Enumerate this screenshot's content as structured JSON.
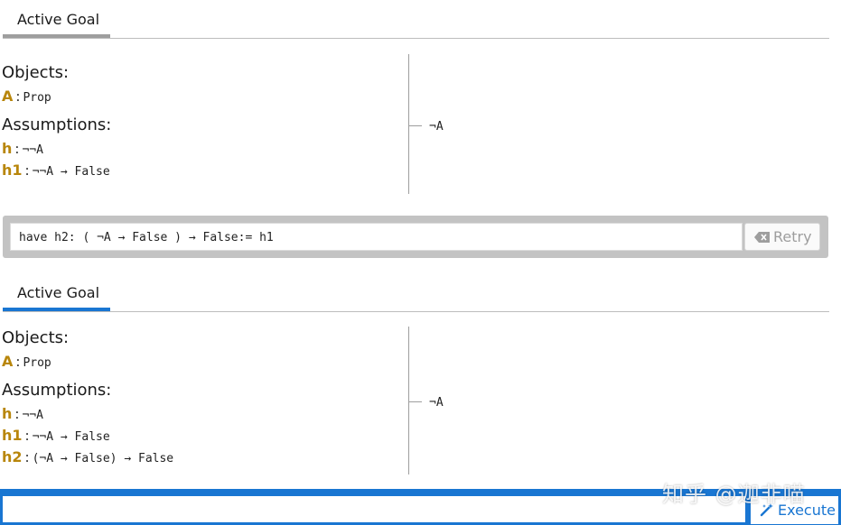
{
  "goal1": {
    "tab_label": "Active Goal",
    "objects_title": "Objects:",
    "objects": [
      {
        "name": "A",
        "type": "Prop"
      }
    ],
    "assumptions_title": "Assumptions:",
    "assumptions": [
      {
        "name": "h",
        "type": "¬¬A"
      },
      {
        "name": "h1",
        "type": "¬¬A → False"
      }
    ],
    "target": "¬A"
  },
  "command": {
    "text": "have h2: ( ¬A → False ) → False:= h1",
    "retry_label": "Retry"
  },
  "goal2": {
    "tab_label": "Active Goal",
    "objects_title": "Objects:",
    "objects": [
      {
        "name": "A",
        "type": "Prop"
      }
    ],
    "assumptions_title": "Assumptions:",
    "assumptions": [
      {
        "name": "h",
        "type": "¬¬A"
      },
      {
        "name": "h1",
        "type": "¬¬A → False"
      },
      {
        "name": "h2",
        "type": "(¬A → False) → False"
      }
    ],
    "target": "¬A"
  },
  "bottom": {
    "input_value": "",
    "execute_label": "Execute"
  },
  "watermark": "知乎 @迦非喵",
  "colors": {
    "accent": "#1976d2",
    "hyp_name": "#b8860b",
    "command_bar": "#c3c3c3"
  }
}
